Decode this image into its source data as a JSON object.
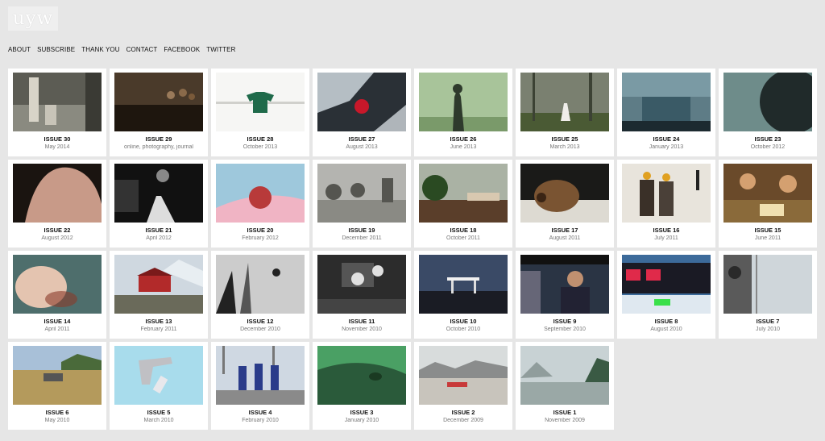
{
  "logo": {
    "text": "uyw"
  },
  "nav": {
    "items": [
      {
        "label": "ABOUT",
        "name": "nav-about"
      },
      {
        "label": "SUBSCRIBE",
        "name": "nav-subscribe"
      },
      {
        "label": "THANK YOU",
        "name": "nav-thank-you"
      },
      {
        "label": "CONTACT",
        "name": "nav-contact"
      },
      {
        "label": "FACEBOOK",
        "name": "nav-facebook"
      },
      {
        "label": "TWITTER",
        "name": "nav-twitter"
      }
    ]
  },
  "issues": [
    {
      "title": "ISSUE 30",
      "date": "May 2014",
      "scene": "figures-garden",
      "colors": [
        "#8a8a80",
        "#3a3a34"
      ]
    },
    {
      "title": "ISSUE 29",
      "date": "online, photography, journal",
      "scene": "dark-group",
      "colors": [
        "#4a3a2a",
        "#1e160e"
      ]
    },
    {
      "title": "ISSUE 28",
      "date": "October 2013",
      "scene": "green-shirt",
      "colors": [
        "#f6f6f4",
        "#1f6a4a"
      ]
    },
    {
      "title": "ISSUE 27",
      "date": "August 2013",
      "scene": "ice-red",
      "colors": [
        "#2a3036",
        "#d8e2e8"
      ]
    },
    {
      "title": "ISSUE 26",
      "date": "June 2013",
      "scene": "fog-figure",
      "colors": [
        "#a8c49a",
        "#2e3a2c"
      ]
    },
    {
      "title": "ISSUE 25",
      "date": "March 2013",
      "scene": "forest-dress",
      "colors": [
        "#7a8070",
        "#3c4234"
      ]
    },
    {
      "title": "ISSUE 24",
      "date": "January 2013",
      "scene": "teal-wall",
      "colors": [
        "#5e7c86",
        "#1c2a30"
      ]
    },
    {
      "title": "ISSUE 23",
      "date": "October 2012",
      "scene": "dark-sphere",
      "colors": [
        "#6e8c8a",
        "#202a2a"
      ]
    },
    {
      "title": "ISSUE 22",
      "date": "August 2012",
      "scene": "back",
      "colors": [
        "#1a1410",
        "#c89a88"
      ]
    },
    {
      "title": "ISSUE 21",
      "date": "April 2012",
      "scene": "bw-night",
      "colors": [
        "#111111",
        "#dddddd"
      ]
    },
    {
      "title": "ISSUE 20",
      "date": "February 2012",
      "scene": "pomegranate",
      "colors": [
        "#9ec8dc",
        "#f0b4c4"
      ]
    },
    {
      "title": "ISSUE 19",
      "date": "December 2011",
      "scene": "gray-trees",
      "colors": [
        "#b4b4b0",
        "#555550"
      ]
    },
    {
      "title": "ISSUE 18",
      "date": "October 2011",
      "scene": "trees-road",
      "colors": [
        "#aab2a4",
        "#5a3e2a"
      ]
    },
    {
      "title": "ISSUE 17",
      "date": "August 2011",
      "scene": "bear",
      "colors": [
        "#1a1a18",
        "#7a5432"
      ]
    },
    {
      "title": "ISSUE 16",
      "date": "July 2011",
      "scene": "women-snow",
      "colors": [
        "#e8e4dc",
        "#3a3028"
      ]
    },
    {
      "title": "ISSUE 15",
      "date": "June 2011",
      "scene": "kitchen",
      "colors": [
        "#6a4a2a",
        "#d4a070"
      ]
    },
    {
      "title": "ISSUE 14",
      "date": "April 2011",
      "scene": "face-water",
      "colors": [
        "#4e6e6c",
        "#e4c4b0"
      ]
    },
    {
      "title": "ISSUE 13",
      "date": "February 2011",
      "scene": "red-house",
      "colors": [
        "#cfd8e0",
        "#b22a2a"
      ]
    },
    {
      "title": "ISSUE 12",
      "date": "December 2010",
      "scene": "bw-branches",
      "colors": [
        "#cccccc",
        "#222222"
      ]
    },
    {
      "title": "ISSUE 11",
      "date": "November 2010",
      "scene": "office",
      "colors": [
        "#2c2c2c",
        "#e0e0e0"
      ]
    },
    {
      "title": "ISSUE 10",
      "date": "October 2010",
      "scene": "gas-station",
      "colors": [
        "#3a4a66",
        "#1a1c24"
      ]
    },
    {
      "title": "ISSUE 9",
      "date": "September 2010",
      "scene": "car-man",
      "colors": [
        "#2a3444",
        "#c09070"
      ]
    },
    {
      "title": "ISSUE 8",
      "date": "August 2010",
      "scene": "red-windows",
      "colors": [
        "#3c6a9a",
        "#e02a4a"
      ]
    },
    {
      "title": "ISSUE 7",
      "date": "July 2010",
      "scene": "window",
      "colors": [
        "#cfd6da",
        "#2a2a2a"
      ]
    },
    {
      "title": "ISSUE 6",
      "date": "May 2010",
      "scene": "field-car",
      "colors": [
        "#a8c0d8",
        "#b49a5c"
      ]
    },
    {
      "title": "ISSUE 5",
      "date": "March 2010",
      "scene": "gun",
      "colors": [
        "#a8dcec",
        "#c0c0c4"
      ]
    },
    {
      "title": "ISSUE 4",
      "date": "February 2010",
      "scene": "runners",
      "colors": [
        "#cfd8e2",
        "#2a3c8a"
      ]
    },
    {
      "title": "ISSUE 3",
      "date": "January 2010",
      "scene": "green-net",
      "colors": [
        "#4aa064",
        "#2a5a3a"
      ]
    },
    {
      "title": "ISSUE 2",
      "date": "December 2009",
      "scene": "lot-mountains",
      "colors": [
        "#d8dcdc",
        "#8a8c8c"
      ]
    },
    {
      "title": "ISSUE 1",
      "date": "November 2009",
      "scene": "lake-mist",
      "colors": [
        "#c8d2d4",
        "#6a7a76"
      ]
    }
  ]
}
